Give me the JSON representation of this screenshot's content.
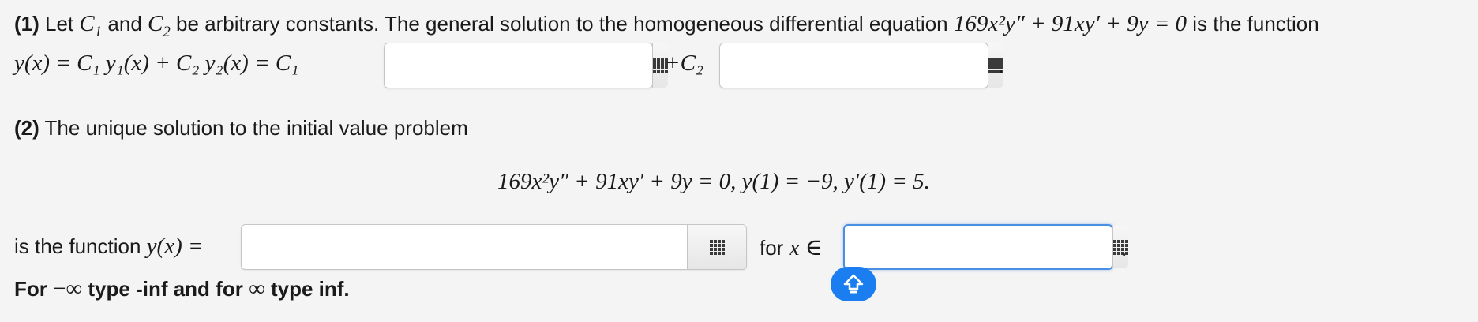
{
  "part1": {
    "label": "(1)",
    "text_let": "Let",
    "c1": "C",
    "c1_sub": "1",
    "and": "and",
    "c2": "C",
    "c2_sub": "2",
    "rest": "be arbitrary constants. The general solution to the homogeneous differential equation",
    "equation": "169x²y″ + 91xy′ + 9y = 0",
    "is_the_function": "is the function",
    "line2_left": "y(x) = C₁ y₁(x) + C₂ y₂(x) = C₁",
    "plus_c2": "+C₂",
    "period": ".",
    "input1_value": "",
    "input2_value": ""
  },
  "part2": {
    "label": "(2)",
    "text": "The unique solution to the initial value problem",
    "display_equation": "169x²y″ + 91xy′ + 9y = 0,  y(1) = −9,  y′(1) = 5.",
    "is_the_function": "is the function",
    "y_of_x": "y(x) =",
    "for_x_in": "for",
    "x_in": "x ∈",
    "period": ".",
    "input3_value": "",
    "input4_value": ""
  },
  "note": {
    "for": "For",
    "neg_inf_symbol": "−∞",
    "type_neg": "type -inf and for",
    "inf_symbol": "∞",
    "type_pos": "type inf."
  },
  "icons": {
    "palette": "grid-icon",
    "fab": "shift-arrow-icon"
  },
  "colors": {
    "accent": "#1a7df0",
    "focus_border": "#4a90e2",
    "background": "#f4f4f4"
  }
}
